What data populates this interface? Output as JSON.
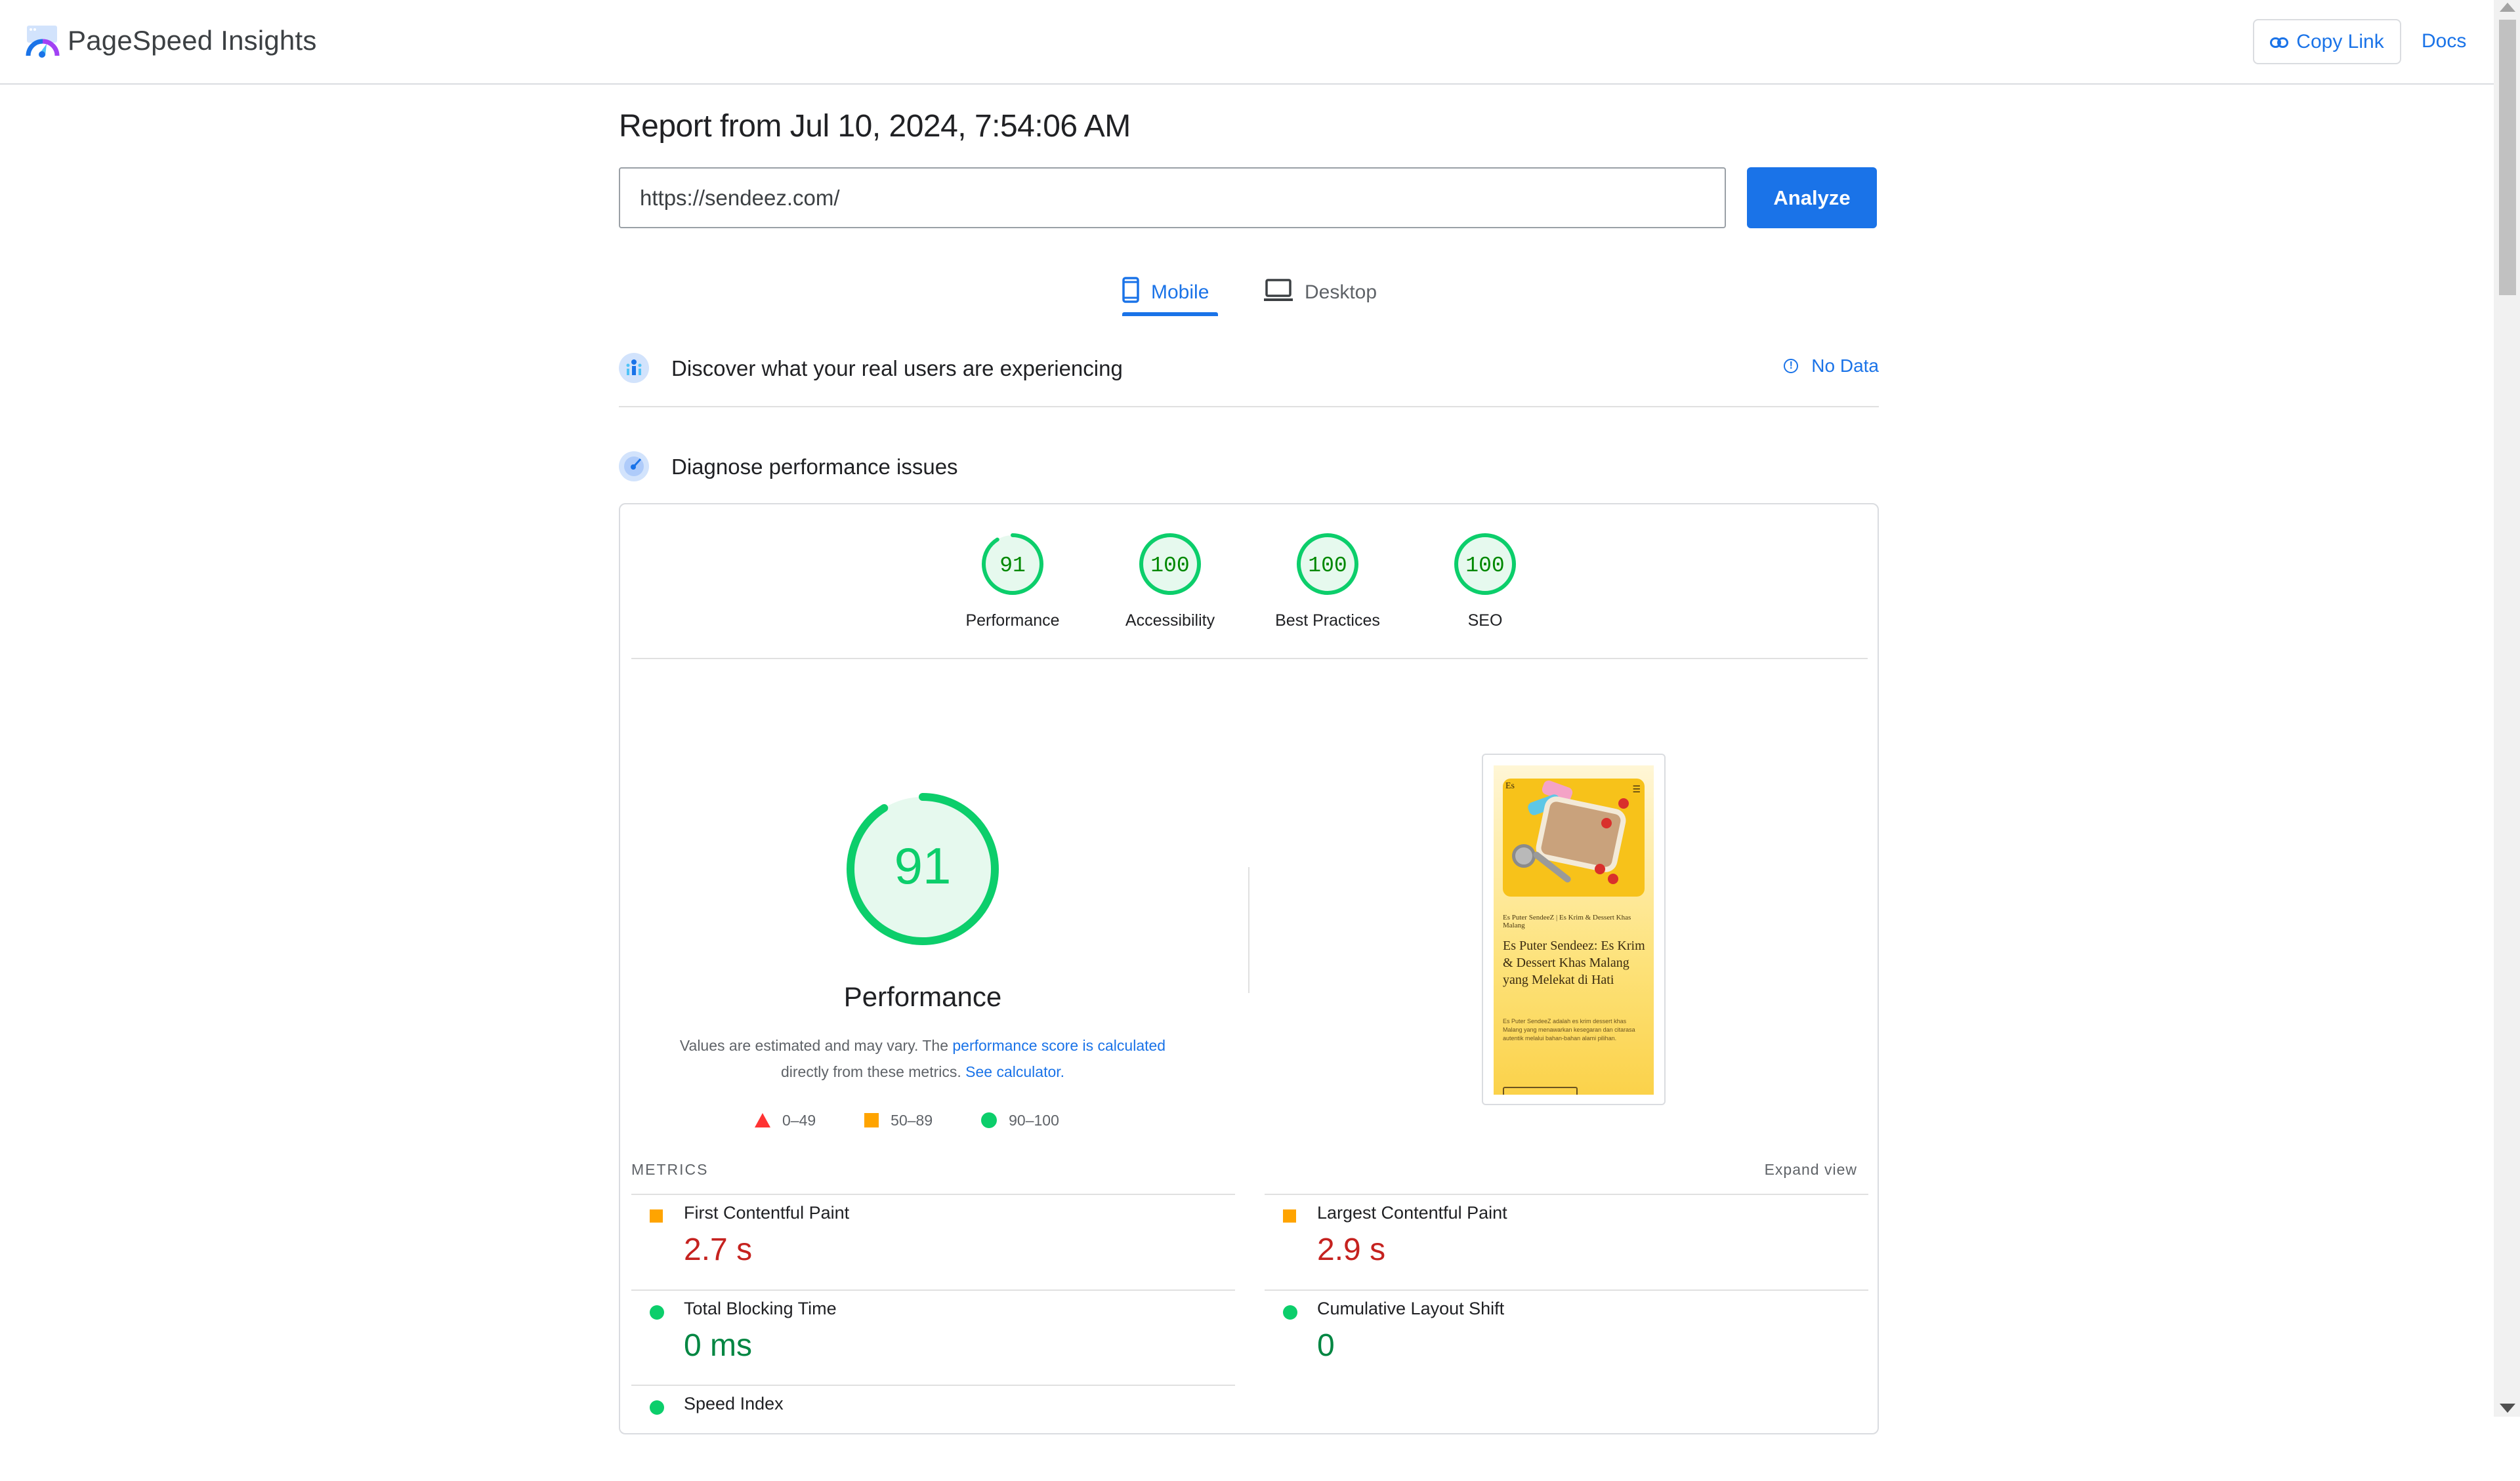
{
  "header": {
    "app_title": "PageSpeed Insights",
    "copy_link_label": "Copy Link",
    "docs_label": "Docs"
  },
  "report": {
    "title": "Report from Jul 10, 2024, 7:54:06 AM",
    "url_value": "https://sendeez.com/",
    "analyze_label": "Analyze"
  },
  "tabs": [
    {
      "label": "Mobile",
      "icon": "smartphone-icon",
      "active": true
    },
    {
      "label": "Desktop",
      "icon": "laptop-icon",
      "active": false
    }
  ],
  "sections": {
    "real_users": {
      "title": "Discover what your real users are experiencing",
      "status": "No Data"
    },
    "diagnose": {
      "title": "Diagnose performance issues"
    }
  },
  "scores": [
    {
      "label": "Performance",
      "score": "91",
      "value": 91
    },
    {
      "label": "Accessibility",
      "score": "100",
      "value": 100
    },
    {
      "label": "Best Practices",
      "score": "100",
      "value": 100
    },
    {
      "label": "SEO",
      "score": "100",
      "value": 100
    }
  ],
  "performance": {
    "score": "91",
    "value": 91,
    "title": "Performance",
    "desc_prefix": "Values are estimated and may vary. The ",
    "desc_link1": "performance score is calculated",
    "desc_middle": " directly from these metrics. ",
    "desc_link2": "See calculator.",
    "legend": [
      {
        "shape": "triangle",
        "range": "0–49",
        "color": "#ff3333"
      },
      {
        "shape": "square",
        "range": "50–89",
        "color": "#ffa400"
      },
      {
        "shape": "circle",
        "range": "90–100",
        "color": "#0cce6b"
      }
    ]
  },
  "screenshot": {
    "logo_text": "Es",
    "kicker": "Es Puter SendeeZ | Es Krim & Dessert Khas Malang",
    "heading": "Es Puter Sendeez: Es Krim & Dessert Khas Malang yang Melekat di Hati",
    "body": "Es Puter SendeeZ adalah es krim dessert khas Malang yang menawarkan kesegaran dan citarasa autentik melalui bahan-bahan alami pilihan."
  },
  "metrics": {
    "label": "METRICS",
    "expand_label": "Expand view",
    "items": [
      {
        "name": "First Contentful Paint",
        "value": "2.7 s",
        "rating": "average"
      },
      {
        "name": "Largest Contentful Paint",
        "value": "2.9 s",
        "rating": "average"
      },
      {
        "name": "Total Blocking Time",
        "value": "0 ms",
        "rating": "good"
      },
      {
        "name": "Cumulative Layout Shift",
        "value": "0",
        "rating": "good"
      },
      {
        "name": "Speed Index",
        "value": "",
        "rating": "good"
      }
    ]
  },
  "colors": {
    "accent": "#1a73e8",
    "pass": "#0cce6b",
    "average": "#ffa400",
    "fail": "#ff3333",
    "pass_text": "#018642",
    "avg_text": "#c5221f"
  }
}
